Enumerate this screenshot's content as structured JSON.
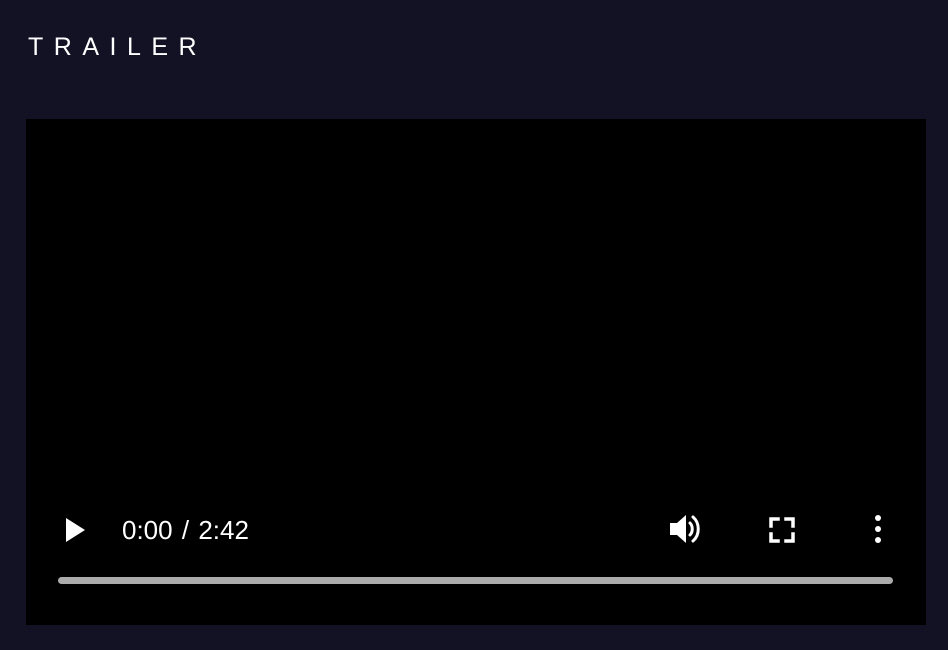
{
  "section": {
    "title": "TRAILER"
  },
  "video": {
    "current_time": "0:00",
    "time_separator": "/",
    "duration": "2:42",
    "progress": 0,
    "controls": {
      "play_icon": "play-icon",
      "volume_icon": "volume-icon",
      "fullscreen_icon": "fullscreen-icon",
      "more_icon": "more-vertical-icon"
    }
  },
  "colors": {
    "page_background": "#131124",
    "player_background": "#000000",
    "control_foreground": "#ffffff",
    "progress_track": "#ababab"
  }
}
